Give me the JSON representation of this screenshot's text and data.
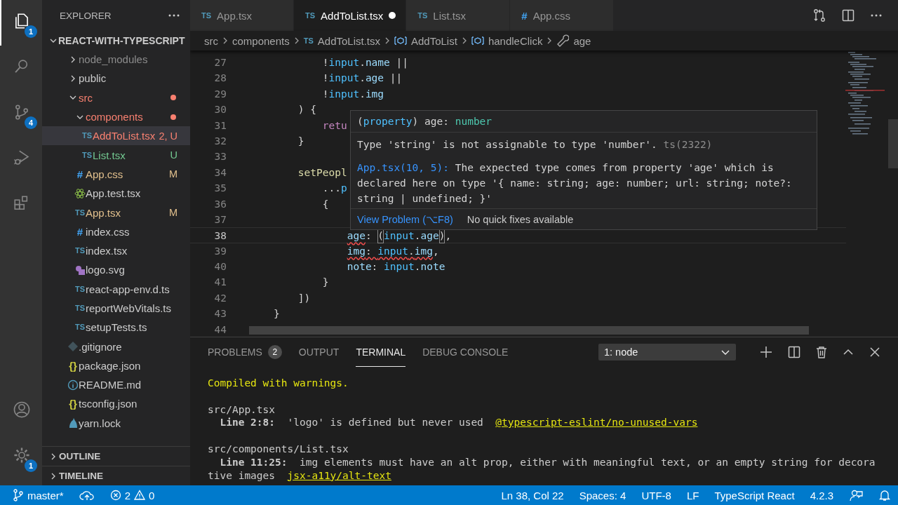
{
  "activity_bar": {
    "top": [
      {
        "kind": "files",
        "selected": true,
        "badge": "1"
      },
      {
        "kind": "search",
        "selected": false
      },
      {
        "kind": "scm",
        "selected": false,
        "badge": "4"
      },
      {
        "kind": "debug",
        "selected": false
      },
      {
        "kind": "extensions",
        "selected": false
      }
    ],
    "bottom": [
      {
        "kind": "account"
      },
      {
        "kind": "settings",
        "badge": "1"
      }
    ]
  },
  "sidebar": {
    "title": "EXPLORER",
    "root": {
      "name": "REACT-WITH-TYPESCRIPT",
      "expanded": true,
      "children": [
        {
          "name": "node_modules",
          "kind": "folder",
          "color": "#8c8c8c",
          "dot": false,
          "expanded": false,
          "selected": false
        },
        {
          "name": "public",
          "kind": "folder",
          "color": "#cccccc",
          "dot": false,
          "expanded": false,
          "selected": false
        },
        {
          "name": "src",
          "kind": "folder",
          "color": "#f88070",
          "dot": true,
          "expanded": true,
          "selected": false,
          "children": [
            {
              "name": "components",
              "kind": "folder",
              "color": "#f88070",
              "dot": true,
              "expanded": true,
              "selected": false,
              "children": [
                {
                  "name": "AddToList.tsx",
                  "kind": "ts",
                  "glyph": "TS",
                  "color": "#f88070",
                  "badge": "2, U",
                  "selected": true
                },
                {
                  "name": "List.tsx",
                  "kind": "ts",
                  "glyph": "TS",
                  "color": "#73c991",
                  "badge": "U",
                  "selected": false
                }
              ]
            },
            {
              "name": "App.css",
              "kind": "css",
              "glyph": "#",
              "color": "#e2c08d",
              "badge": "M",
              "selected": false
            },
            {
              "name": "App.test.tsx",
              "kind": "react",
              "color": "#cccccc",
              "selected": false
            },
            {
              "name": "App.tsx",
              "kind": "ts",
              "glyph": "TS",
              "color": "#e2c08d",
              "badge": "M",
              "selected": false
            },
            {
              "name": "index.css",
              "kind": "css",
              "glyph": "#",
              "color": "#cccccc",
              "selected": false
            },
            {
              "name": "index.tsx",
              "kind": "ts",
              "glyph": "TS",
              "color": "#cccccc",
              "selected": false
            },
            {
              "name": "logo.svg",
              "kind": "image",
              "color": "#cccccc",
              "selected": false
            },
            {
              "name": "react-app-env.d.ts",
              "kind": "ts",
              "glyph": "TS",
              "color": "#cccccc",
              "selected": false
            },
            {
              "name": "reportWebVitals.ts",
              "kind": "ts",
              "glyph": "TS",
              "color": "#cccccc",
              "selected": false
            },
            {
              "name": "setupTests.ts",
              "kind": "ts",
              "glyph": "TS",
              "color": "#cccccc",
              "selected": false
            }
          ]
        },
        {
          "name": ".gitignore",
          "kind": "git",
          "color": "#cccccc",
          "selected": false
        },
        {
          "name": "package.json",
          "kind": "json",
          "glyph": "{}",
          "color": "#cccccc",
          "selected": false
        },
        {
          "name": "README.md",
          "kind": "info",
          "color": "#cccccc",
          "selected": false
        },
        {
          "name": "tsconfig.json",
          "kind": "json",
          "glyph": "{}",
          "color": "#cccccc",
          "selected": false
        },
        {
          "name": "yarn.lock",
          "kind": "yarn",
          "color": "#cccccc",
          "selected": false
        }
      ]
    },
    "sections": [
      {
        "title": "OUTLINE",
        "expanded": false
      },
      {
        "title": "TIMELINE",
        "expanded": false
      }
    ]
  },
  "editor": {
    "tabs": [
      {
        "glyph": "TS",
        "kind": "ts",
        "label": "App.tsx",
        "selected": false,
        "dirty": false
      },
      {
        "glyph": "TS",
        "kind": "ts",
        "label": "AddToList.tsx",
        "selected": true,
        "dirty": true
      },
      {
        "glyph": "TS",
        "kind": "ts",
        "label": "List.tsx",
        "selected": false,
        "dirty": false
      },
      {
        "glyph": "#",
        "kind": "css",
        "label": "App.css",
        "selected": false,
        "dirty": false
      }
    ],
    "breadcrumb": [
      {
        "kind": "folder",
        "text": "src"
      },
      {
        "kind": "folder",
        "text": "components"
      },
      {
        "kind": "file",
        "glyph": "TS",
        "text": "AddToList.tsx"
      },
      {
        "kind": "symbol",
        "text": "AddToList"
      },
      {
        "kind": "symbol",
        "text": "handleClick"
      },
      {
        "kind": "property",
        "text": "age"
      }
    ],
    "lines": [
      {
        "number": "27",
        "current": false,
        "tokens": [
          {
            "text": "            !",
            "kind": "punct",
            "err": false
          },
          {
            "text": "input",
            "kind": "var",
            "err": false
          },
          {
            "text": ".",
            "kind": "punct",
            "err": false
          },
          {
            "text": "name",
            "kind": "prop",
            "err": false
          },
          {
            "text": " ||",
            "kind": "punct",
            "err": false
          }
        ]
      },
      {
        "number": "28",
        "current": false,
        "tokens": [
          {
            "text": "            !",
            "kind": "punct",
            "err": false
          },
          {
            "text": "input",
            "kind": "var",
            "err": false
          },
          {
            "text": ".",
            "kind": "punct",
            "err": false
          },
          {
            "text": "age",
            "kind": "prop",
            "err": false
          },
          {
            "text": " ||",
            "kind": "punct",
            "err": false
          }
        ]
      },
      {
        "number": "29",
        "current": false,
        "tokens": [
          {
            "text": "            !",
            "kind": "punct",
            "err": false
          },
          {
            "text": "input",
            "kind": "var",
            "err": false
          },
          {
            "text": ".",
            "kind": "punct",
            "err": false
          },
          {
            "text": "img",
            "kind": "prop",
            "err": false
          }
        ]
      },
      {
        "number": "30",
        "current": false,
        "tokens": [
          {
            "text": "        ) {",
            "kind": "punct",
            "err": false
          }
        ]
      },
      {
        "number": "31",
        "current": false,
        "tokens": [
          {
            "text": "            retu",
            "kind": "keyword",
            "err": false
          }
        ]
      },
      {
        "number": "32",
        "current": false,
        "tokens": [
          {
            "text": "        }",
            "kind": "punct",
            "err": false
          }
        ]
      },
      {
        "number": "33",
        "current": false
      },
      {
        "number": "34",
        "current": false,
        "tokens": [
          {
            "text": "        setPeopl",
            "kind": "func",
            "err": false
          }
        ]
      },
      {
        "number": "35",
        "current": false,
        "tokens": [
          {
            "text": "            ...",
            "kind": "punct",
            "err": false
          },
          {
            "text": "p",
            "kind": "var",
            "err": false
          }
        ]
      },
      {
        "number": "36",
        "current": false,
        "tokens": [
          {
            "text": "            {",
            "kind": "punct",
            "err": false
          }
        ]
      },
      {
        "number": "37",
        "current": false
      },
      {
        "number": "38",
        "current": true,
        "tokens": [
          {
            "text": "                age",
            "kind": "prop",
            "err": true
          },
          {
            "text": ": ",
            "kind": "punct",
            "err": false
          },
          {
            "text": "(",
            "kind": "bracket",
            "err": false
          },
          {
            "text": "input",
            "kind": "var",
            "err": false
          },
          {
            "text": ".",
            "kind": "punct",
            "err": false
          },
          {
            "text": "age",
            "kind": "prop",
            "err": false
          },
          {
            "text": ")",
            "kind": "bracket",
            "err": false
          },
          {
            "text": ",",
            "kind": "punct",
            "err": false
          }
        ]
      },
      {
        "number": "39",
        "current": false,
        "tokens": [
          {
            "text": "                img",
            "kind": "prop",
            "err": true
          },
          {
            "text": ": ",
            "kind": "punct",
            "err": true
          },
          {
            "text": "input",
            "kind": "var",
            "err": true
          },
          {
            "text": ".",
            "kind": "punct",
            "err": true
          },
          {
            "text": "img",
            "kind": "prop",
            "err": true
          },
          {
            "text": ",",
            "kind": "punct",
            "err": false
          }
        ]
      },
      {
        "number": "40",
        "current": false,
        "tokens": [
          {
            "text": "                note",
            "kind": "prop",
            "err": false
          },
          {
            "text": ": ",
            "kind": "punct",
            "err": false
          },
          {
            "text": "input",
            "kind": "var",
            "err": false
          },
          {
            "text": ".",
            "kind": "punct",
            "err": false
          },
          {
            "text": "note",
            "kind": "prop",
            "err": false
          }
        ]
      },
      {
        "number": "41",
        "current": false,
        "tokens": [
          {
            "text": "            }",
            "kind": "punct",
            "err": false
          }
        ]
      },
      {
        "number": "42",
        "current": false,
        "tokens": [
          {
            "text": "        ])",
            "kind": "punct",
            "err": false
          }
        ]
      },
      {
        "number": "43",
        "current": false,
        "tokens": [
          {
            "text": "    }",
            "kind": "punct",
            "err": false
          }
        ]
      },
      {
        "number": "44",
        "current": false
      }
    ],
    "hover": {
      "signature": [
        {
          "text": "(",
          "kind": "punct",
          "err": false
        },
        {
          "text": "property",
          "kind": "storage",
          "err": false
        },
        {
          "text": ") age: ",
          "kind": "punct",
          "err": false
        },
        {
          "text": "number",
          "kind": "type",
          "err": false
        }
      ],
      "message": "Type 'string' is not assignable to type 'number'.",
      "code": "ts(2322)",
      "source_link": "App.tsx(10, 5):",
      "detail": " The expected type comes from property 'age' which is declared here on type '{ name: string; age: number; url: string; note?: string | undefined; }'",
      "actions": [
        {
          "kind": "link",
          "text": "View Problem (⌥F8)"
        },
        {
          "kind": "text",
          "text": "No quick fixes available"
        }
      ]
    }
  },
  "panel": {
    "tabs": [
      {
        "label": "PROBLEMS",
        "count": "2",
        "selected": false
      },
      {
        "label": "OUTPUT",
        "selected": false
      },
      {
        "label": "TERMINAL",
        "selected": true
      },
      {
        "label": "DEBUG CONSOLE",
        "selected": false
      }
    ],
    "terminal_selector": "1: node",
    "terminal": [
      {
        "kind": "text",
        "segments": [
          {
            "kind": "warn",
            "text": "Compiled with warnings."
          }
        ]
      },
      {
        "kind": "blank"
      },
      {
        "kind": "text",
        "segments": [
          {
            "kind": "plain",
            "text": "src/App.tsx"
          }
        ]
      },
      {
        "kind": "text",
        "segments": [
          {
            "kind": "bold",
            "text": "  Line 2:8:"
          },
          {
            "kind": "plain",
            "text": "  'logo' is defined but never used  "
          },
          {
            "kind": "link",
            "text": "@typescript-eslint/no-unused-vars"
          }
        ]
      },
      {
        "kind": "blank"
      },
      {
        "kind": "text",
        "segments": [
          {
            "kind": "plain",
            "text": "src/components/List.tsx"
          }
        ]
      },
      {
        "kind": "text",
        "segments": [
          {
            "kind": "bold",
            "text": "  Line 11:25:"
          },
          {
            "kind": "plain",
            "text": "  img elements must have an alt prop, either with meaningful text, or an empty string for decora"
          }
        ]
      },
      {
        "kind": "text",
        "segments": [
          {
            "kind": "plain",
            "text": "tive images  "
          },
          {
            "kind": "link",
            "text": "jsx-a11y/alt-text"
          }
        ]
      }
    ]
  },
  "status_bar": {
    "left": [
      {
        "kind": "branch",
        "text": "master*"
      },
      {
        "kind": "sync"
      },
      {
        "kind": "problems",
        "errors": "2",
        "warnings": "0"
      }
    ],
    "right": [
      {
        "kind": "text",
        "text": "Ln 38, Col 22"
      },
      {
        "kind": "text",
        "text": "Spaces: 4"
      },
      {
        "kind": "text",
        "text": "UTF-8"
      },
      {
        "kind": "text",
        "text": "LF"
      },
      {
        "kind": "text",
        "text": "TypeScript React"
      },
      {
        "kind": "text",
        "text": "4.2.3"
      },
      {
        "kind": "feedback"
      },
      {
        "kind": "bell"
      }
    ]
  }
}
